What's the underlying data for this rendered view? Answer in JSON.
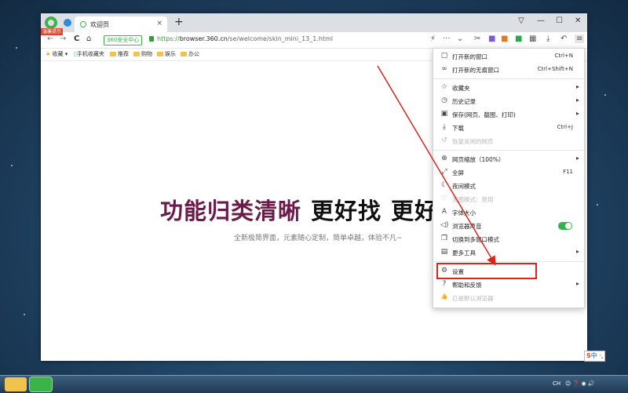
{
  "browser": {
    "logo_badge": "温馨提示",
    "tab_title": "欢迎页",
    "tab_close": "×",
    "new_tab": "+",
    "win_min": "—",
    "win_max": "☐",
    "win_close": "✕",
    "skin": "▽",
    "nav_back": "←",
    "nav_forward": "→",
    "nav_reload": "C",
    "nav_home": "⌂",
    "safe_badge": "360安全中心",
    "url_scheme": "https://",
    "url_host": "browser.360.cn",
    "url_path": "/se/welcome/skin_mini_13_1.html"
  },
  "bookmarks": [
    {
      "label": "收藏",
      "type": "star"
    },
    {
      "label": "手机收藏夹",
      "type": "phone"
    },
    {
      "label": "推荐",
      "type": "folder"
    },
    {
      "label": "购物",
      "type": "folder"
    },
    {
      "label": "娱乐",
      "type": "folder"
    },
    {
      "label": "办公",
      "type": "folder"
    }
  ],
  "content": {
    "headline_part1": "功能归类清晰",
    "headline_part2": "更好找",
    "headline_part3": "更好",
    "subline": "全新极简界面，元素随心定制，简单卓越，体验不凡~"
  },
  "menu": [
    {
      "label": "打开新的窗口",
      "shortcut": "Ctrl+N",
      "icon": "window-icon",
      "glyph": "▢"
    },
    {
      "label": "打开新的无痕窗口",
      "shortcut": "Ctrl+Shift+N",
      "icon": "incognito-icon",
      "glyph": "∞"
    },
    {
      "label": "收藏夹",
      "arrow": true,
      "icon": "star-icon",
      "glyph": "☆"
    },
    {
      "label": "历史记录",
      "arrow": true,
      "icon": "history-icon",
      "glyph": "◷"
    },
    {
      "label": "保存(网页、截图、打印)",
      "arrow": true,
      "icon": "save-icon",
      "glyph": "▣"
    },
    {
      "label": "下载",
      "shortcut": "Ctrl+J",
      "icon": "download-icon",
      "glyph": "⤓"
    },
    {
      "label": "恢复关闭的网页",
      "disabled": true,
      "icon": "restore-icon",
      "glyph": "↺"
    },
    {
      "label": "网页缩放（100%）",
      "arrow": true,
      "icon": "zoom-icon",
      "glyph": "⊕"
    },
    {
      "label": "全屏",
      "shortcut": "F11",
      "icon": "fullscreen-icon",
      "glyph": "⤢"
    },
    {
      "label": "夜间模式",
      "icon": "night-mode-icon",
      "glyph": "☾"
    },
    {
      "label": "无图模式：禁用",
      "disabled": true,
      "icon": "no-image-icon",
      "glyph": "♡"
    },
    {
      "label": "字体大小",
      "icon": "font-size-icon",
      "glyph": "A"
    },
    {
      "label": "浏览器声音",
      "toggle": true,
      "icon": "sound-icon",
      "glyph": "◁)"
    },
    {
      "label": "切换到多窗口模式",
      "icon": "multi-window-icon",
      "glyph": "❐"
    },
    {
      "label": "更多工具",
      "arrow": true,
      "icon": "tools-icon",
      "glyph": "▤"
    },
    {
      "label": "设置",
      "icon": "settings-gear-icon",
      "glyph": "⚙"
    },
    {
      "label": "帮助和反馈",
      "arrow": true,
      "icon": "help-icon",
      "glyph": "?"
    },
    {
      "label": "已是默认浏览器",
      "disabled": true,
      "icon": "thumb-up-icon",
      "glyph": "👍"
    }
  ],
  "menu_arrow_glyph": "▸",
  "tray": {
    "ime_s": "S",
    "ime_zh": "中",
    "lang": "CH"
  },
  "colors": {
    "accent_green": "#36b24a",
    "annotation_red": "#d9241b"
  }
}
